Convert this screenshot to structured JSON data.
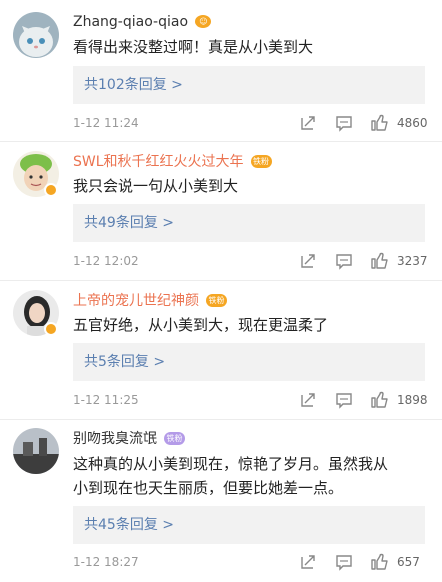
{
  "comments": [
    {
      "username": "Zhang-qiao-qiao",
      "tag": "",
      "text_lines": [
        "看得出来没整过啊！真是从小美到大"
      ],
      "reply_label": "共102条回复 >",
      "time": "1-12 11:24",
      "likes": "4860"
    },
    {
      "username": "SWL和秋千红红火火过大年",
      "tag": "铁粉",
      "text_lines": [
        "我只会说一句从小美到大"
      ],
      "reply_label": "共49条回复 >",
      "time": "1-12 12:02",
      "likes": "3237"
    },
    {
      "username": "上帝的宠儿世纪神颜",
      "tag": "铁粉",
      "text_lines": [
        "五官好绝，从小美到大，现在更温柔了"
      ],
      "reply_label": "共5条回复 >",
      "time": "1-12 11:25",
      "likes": "1898"
    },
    {
      "username": "别吻我臭流氓",
      "tag": "铁粉",
      "text_lines": [
        "这种真的从小美到现在，惊艳了岁月。虽然我从",
        "小到现在也天生丽质，但要比她差一点。"
      ],
      "reply_label": "共45条回复 >",
      "time": "1-12 18:27",
      "likes": "657"
    }
  ],
  "colors": {
    "username_highlight": "#eb7350",
    "link": "#5b7fb0",
    "reply_bg": "#f2f2f2",
    "badge": "#f5a623"
  },
  "icons": [
    "share-icon",
    "comment-icon",
    "like-icon",
    "verified-badge-icon"
  ]
}
